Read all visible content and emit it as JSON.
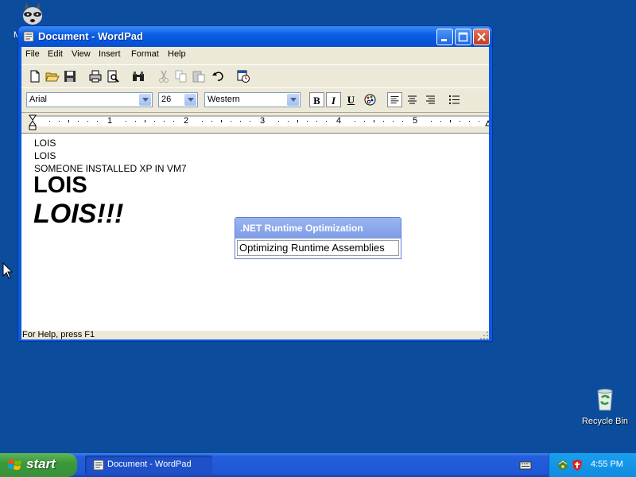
{
  "window": {
    "title": "Document - WordPad",
    "menu": [
      "File",
      "Edit",
      "View",
      "Insert",
      "Format",
      "Help"
    ]
  },
  "format_bar": {
    "font": "Arial",
    "size": "26",
    "script": "Western",
    "bold_label": "B",
    "italic_label": "I",
    "underline_label": "U"
  },
  "ruler": {
    "marks": [
      "1",
      "2",
      "3",
      "4",
      "5"
    ]
  },
  "document": {
    "lines": [
      "LOIS",
      "LOIS",
      "SOMEONE INSTALLED XP IN VM7",
      "LOIS",
      "LOIS!!!"
    ]
  },
  "status_bar": {
    "text": "For Help, press F1"
  },
  "popup": {
    "title": ".NET Runtime Optimization",
    "message": "Optimizing Runtime Assemblies"
  },
  "desktop": {
    "recycle_bin_label": "Recycle Bin",
    "top_icon_label": "M"
  },
  "taskbar": {
    "start_label": "start",
    "task_label": "Document - WordPad",
    "clock": "4:55 PM"
  },
  "colors": {
    "desktop": "#0b4d9c",
    "titlebar": "#0a5fe6",
    "start_green": "#3c9a3a",
    "tray": "#0f8be0"
  }
}
